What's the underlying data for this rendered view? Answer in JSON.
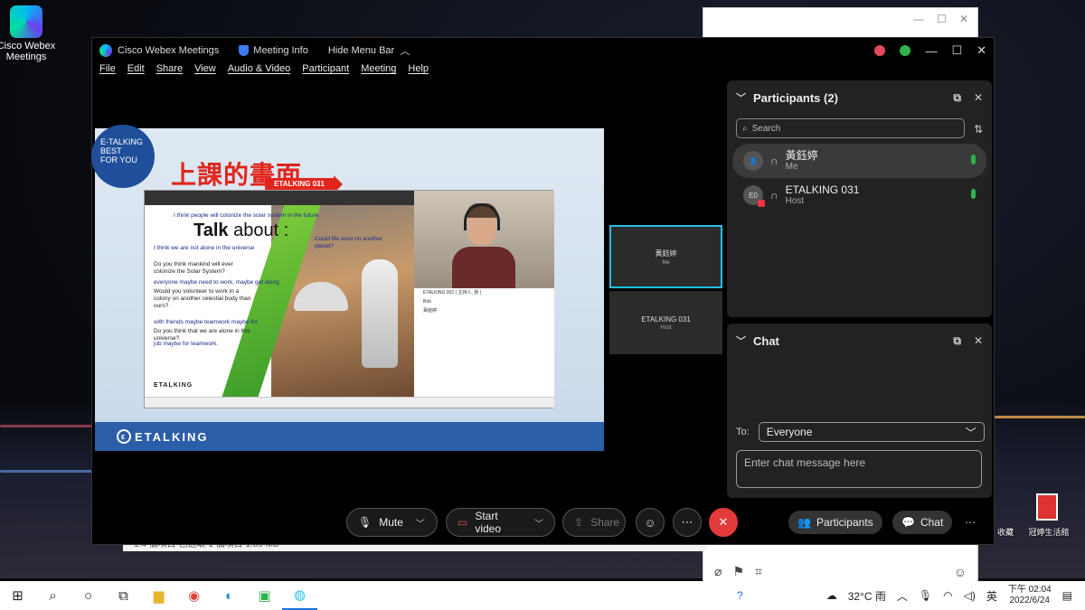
{
  "desktop": {
    "icon_label": "Cisco Webex Meetings",
    "right_icons": [
      "收藏",
      "冠婷生活館"
    ]
  },
  "bg_window": {
    "status_text": "1.4 個項目  已選取 1 個項目 1.89 MB"
  },
  "webex": {
    "app_title": "Cisco Webex Meetings",
    "meeting_info": "Meeting Info",
    "hide_menu": "Hide Menu Bar",
    "menu": [
      "File",
      "Edit",
      "Share",
      "View",
      "Audio & Video",
      "Participant",
      "Meeting",
      "Help"
    ],
    "shared": {
      "badge": [
        "E-TALKING",
        "BEST",
        "FOR YOU"
      ],
      "title": "上課的畫面",
      "tag": "ETALKING 031",
      "talk_bold": "Talk",
      "talk_rest": "about :",
      "lines": [
        "I think people will colonize the solar system in the future",
        "Could life exist on another planet?",
        "I think we are not alone in the universe",
        "Do you think mankind will ever colonize the Solar System?",
        "everyone maybe need to work, maybe get along",
        "Would you volunteer to work in a colony on another celestial body than ours?",
        "with friends maybe teamwork maybe for",
        "Do you think that we are alone in this universe?",
        "job maybe for teamwork."
      ],
      "logo_small": "ETALKING",
      "footer_logo": "ETALKING",
      "inner_plist": [
        "ETALKING 002 ( 主持人, 我 )",
        "Bob",
        "黃鈺婷"
      ]
    },
    "thumbs": [
      {
        "name": "黃鈺婷",
        "sub": "Me"
      },
      {
        "name": "ETALKING 031",
        "sub": "Host"
      }
    ],
    "participants": {
      "title": "Participants (2)",
      "search_placeholder": "Search",
      "list": [
        {
          "name": "黃鈺婷",
          "role": "Me",
          "avatar": ""
        },
        {
          "name": "ETALKING 031",
          "role": "Host",
          "avatar": "E0"
        }
      ]
    },
    "chat": {
      "title": "Chat",
      "to_label": "To:",
      "to_value": "Everyone",
      "input_placeholder": "Enter chat message here"
    },
    "controls": {
      "mute": "Mute",
      "start_video": "Start video",
      "share": "Share",
      "participants": "Participants",
      "chat": "Chat"
    }
  },
  "taskbar": {
    "weather": "32°C 雨",
    "ime": "英",
    "time": "下午 02:04",
    "date": "2022/6/24"
  },
  "colors": {
    "accent": "#1ec1e6",
    "end": "#e33b3b",
    "mic_green": "#2db34a",
    "slide_red": "#e0261c"
  }
}
